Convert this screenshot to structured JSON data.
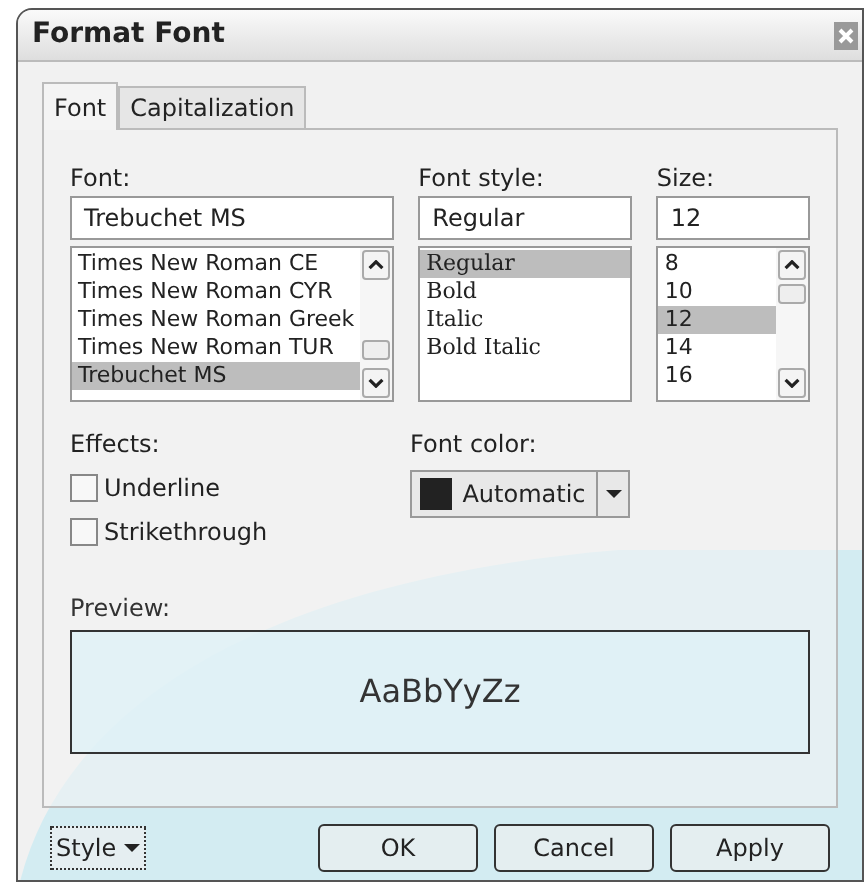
{
  "window": {
    "title": "Format Font"
  },
  "tabs": [
    {
      "label": "Font",
      "selected": true
    },
    {
      "label": "Capitalization",
      "selected": false
    }
  ],
  "font": {
    "label": "Font:",
    "value": "Trebuchet MS",
    "items": [
      {
        "label": "Times New Roman CE",
        "selected": false
      },
      {
        "label": "Times New Roman CYR",
        "selected": false
      },
      {
        "label": "Times New Roman Greek",
        "selected": false
      },
      {
        "label": "Times New Roman TUR",
        "selected": false
      },
      {
        "label": "Trebuchet MS",
        "selected": true
      }
    ]
  },
  "font_style": {
    "label": "Font style:",
    "value": "Regular",
    "items": [
      {
        "label": "Regular",
        "selected": true
      },
      {
        "label": "Bold",
        "selected": false
      },
      {
        "label": "Italic",
        "selected": false
      },
      {
        "label": "Bold Italic",
        "selected": false
      }
    ]
  },
  "size": {
    "label": "Size:",
    "value": "12",
    "items": [
      {
        "label": "8",
        "selected": false
      },
      {
        "label": "10",
        "selected": false
      },
      {
        "label": "12",
        "selected": true
      },
      {
        "label": "14",
        "selected": false
      },
      {
        "label": "16",
        "selected": false
      }
    ]
  },
  "effects": {
    "label": "Effects:",
    "options": [
      {
        "label": "Underline",
        "checked": false
      },
      {
        "label": "Strikethrough",
        "checked": false
      }
    ]
  },
  "font_color": {
    "label": "Font color:",
    "value": "Automatic",
    "color": "#222222"
  },
  "preview": {
    "label": "Preview:",
    "text": "AaBbYyZz"
  },
  "buttons": {
    "style": "Style",
    "ok": "OK",
    "cancel": "Cancel",
    "apply": "Apply"
  }
}
